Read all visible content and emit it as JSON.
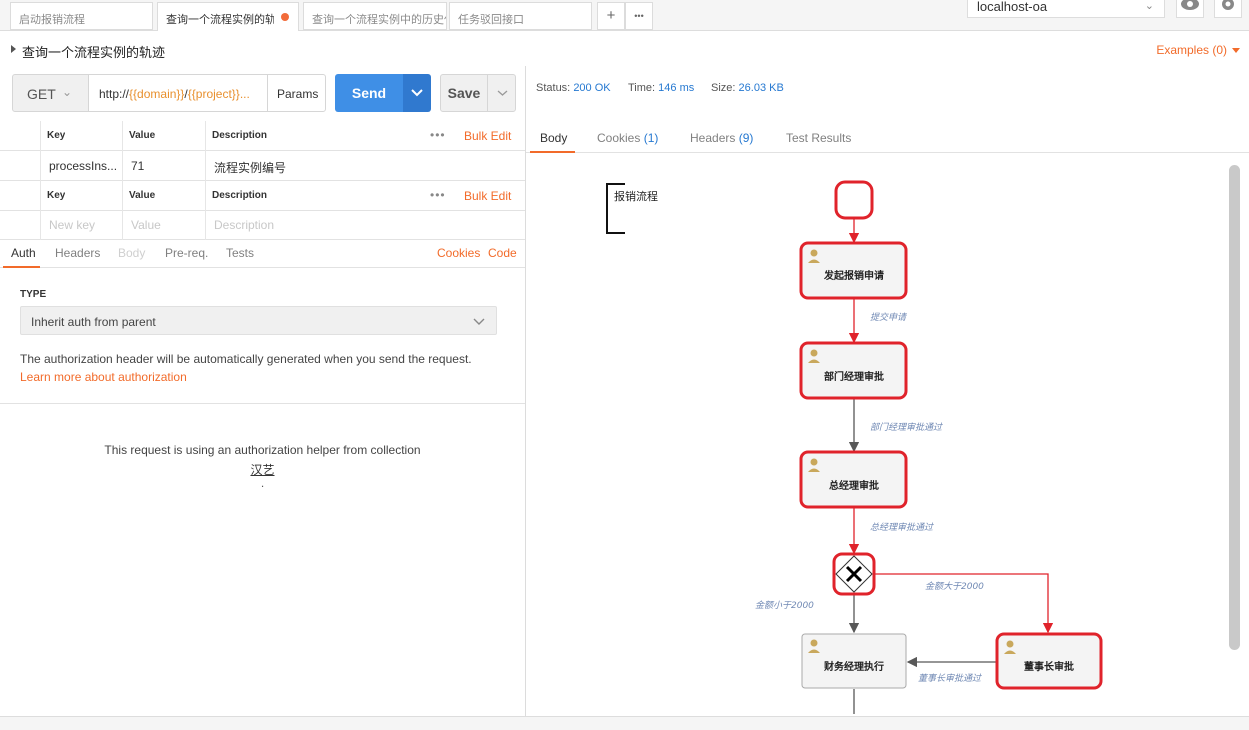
{
  "tabs": [
    {
      "label": "启动报销流程"
    },
    {
      "label": "查询一个流程实例的轨迹"
    },
    {
      "label": "查询一个流程实例中的历史任务"
    },
    {
      "label": "任务驳回接口"
    }
  ],
  "tab_actions": {
    "add": "+",
    "more": "•••"
  },
  "environment": {
    "name": "localhost-oa"
  },
  "request": {
    "title": "查询一个流程实例的轨迹",
    "examples": "Examples (0)",
    "method": "GET",
    "url": {
      "prefix": "http://",
      "domain_var": "{{domain}}",
      "sep": "/",
      "project_var": "{{project}}...",
      "full": "http://{{domain}}/{{project}}..."
    },
    "params_label": "Params",
    "send_label": "Send",
    "save_label": "Save"
  },
  "params_table": {
    "headers": {
      "key": "Key",
      "value": "Value",
      "description": "Description"
    },
    "bulk_edit": "Bulk Edit",
    "rows": [
      {
        "key": "processIns...",
        "value": "71",
        "description": "流程实例编号"
      }
    ]
  },
  "second_table": {
    "headers": {
      "key": "Key",
      "value": "Value",
      "description": "Description"
    },
    "bulk_edit": "Bulk Edit",
    "placeholders": {
      "key": "New key",
      "value": "Value",
      "description": "Description"
    }
  },
  "request_tabs": {
    "auth": "Auth",
    "headers": "Headers",
    "body": "Body",
    "prereq": "Pre-req.",
    "tests": "Tests",
    "cookies": "Cookies",
    "code": "Code"
  },
  "auth": {
    "type_label": "TYPE",
    "selected": "Inherit auth from parent",
    "description": "The authorization header will be automatically generated when you send the request.",
    "learn_more": "Learn more about authorization",
    "helper_text": "This request is using an authorization helper from collection",
    "collection_name": "汉艺",
    "trailing": "."
  },
  "response": {
    "status_label": "Status:",
    "status_value": "200 OK",
    "time_label": "Time:",
    "time_value": "146 ms",
    "size_label": "Size:",
    "size_value": "26.03 KB",
    "tabs": {
      "body": "Body",
      "cookies": "Cookies",
      "cookies_count": "(1)",
      "headers": "Headers",
      "headers_count": "(9)",
      "tests": "Test Results"
    }
  },
  "diagram": {
    "pool_label": "报销流程",
    "tasks": {
      "t1": "发起报销申请",
      "t2": "部门经理审批",
      "t3": "总经理审批",
      "t4": "财务经理执行",
      "t5": "董事长审批"
    },
    "flows": {
      "f1": "提交申请",
      "f2": "部门经理审批通过",
      "f3": "总经理审批通过",
      "f4": "金额大于2000",
      "f5": "金额小于2000",
      "f6": "董事长审批通过"
    },
    "colors": {
      "highlight": "#e0232b",
      "normal": "#585858",
      "task_fill": "#f4f4f4",
      "flow_label": "#7089b4"
    }
  }
}
